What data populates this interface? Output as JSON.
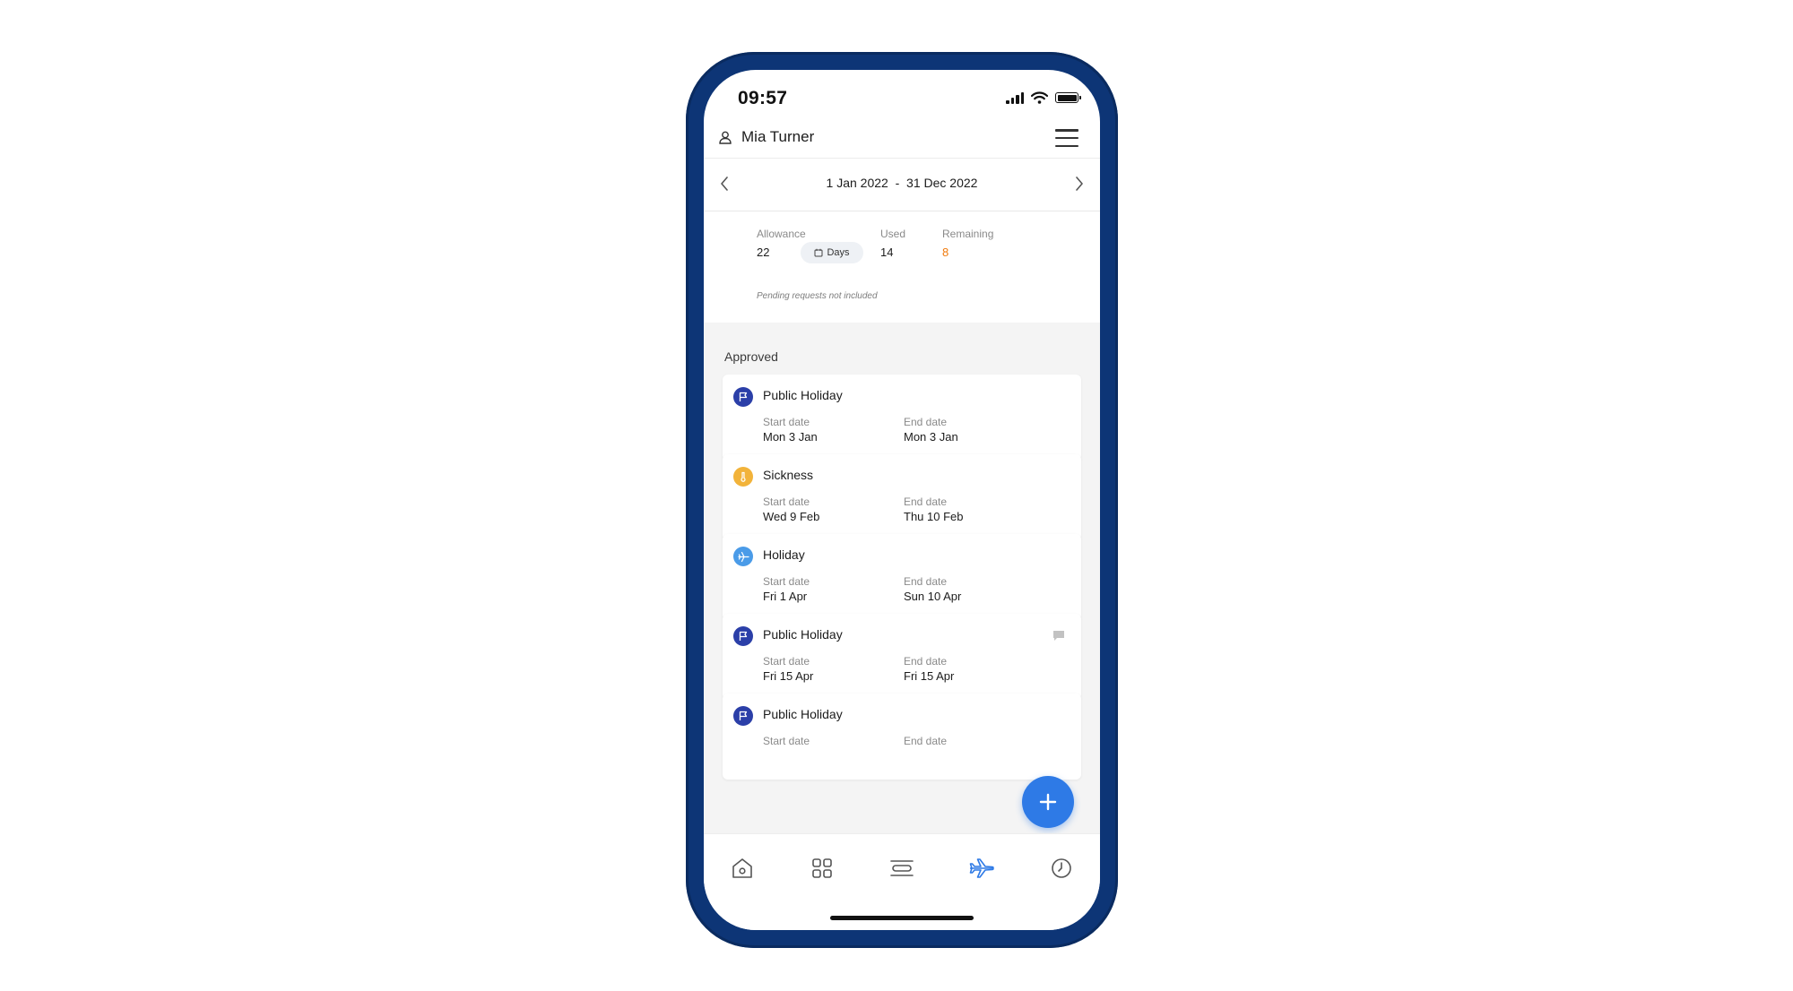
{
  "status_bar": {
    "time": "09:57"
  },
  "header": {
    "user_name": "Mia Turner"
  },
  "date_range": {
    "label": "1 Jan 2022  -  31 Dec 2022"
  },
  "summary": {
    "allowance_label": "Allowance",
    "allowance_value": "22",
    "unit_chip": "Days",
    "used_label": "Used",
    "used_value": "14",
    "remaining_label": "Remaining",
    "remaining_value": "8",
    "pending_note": "Pending requests not included"
  },
  "list": {
    "section_title": "Approved",
    "start_label": "Start date",
    "end_label": "End date",
    "items": [
      {
        "type": "Public Holiday",
        "icon": "flag-icon",
        "start": "Mon 3 Jan",
        "end": "Mon 3 Jan"
      },
      {
        "type": "Sickness",
        "icon": "thermometer-icon",
        "start": "Wed 9 Feb",
        "end": "Thu 10 Feb"
      },
      {
        "type": "Holiday",
        "icon": "plane-icon",
        "start": "Fri 1 Apr",
        "end": "Sun 10 Apr"
      },
      {
        "type": "Public Holiday",
        "icon": "flag-icon",
        "start": "Fri 15 Apr",
        "end": "Fri 15 Apr",
        "has_comment": true
      },
      {
        "type": "Public Holiday",
        "icon": "flag-icon",
        "start": "",
        "end": ""
      }
    ]
  },
  "colors": {
    "frame": "#0d3576",
    "accent": "#2e7ae6",
    "public_holiday": "#2b3fa8",
    "sickness": "#f2b33a",
    "holiday": "#4a9be8",
    "remaining": "#f07a0c"
  },
  "bottom_nav": [
    {
      "name": "home",
      "icon": "home-icon"
    },
    {
      "name": "apps",
      "icon": "grid-icon"
    },
    {
      "name": "timeline",
      "icon": "timeline-icon"
    },
    {
      "name": "absence",
      "icon": "plane-icon",
      "active": true
    },
    {
      "name": "time",
      "icon": "clock-icon"
    }
  ]
}
